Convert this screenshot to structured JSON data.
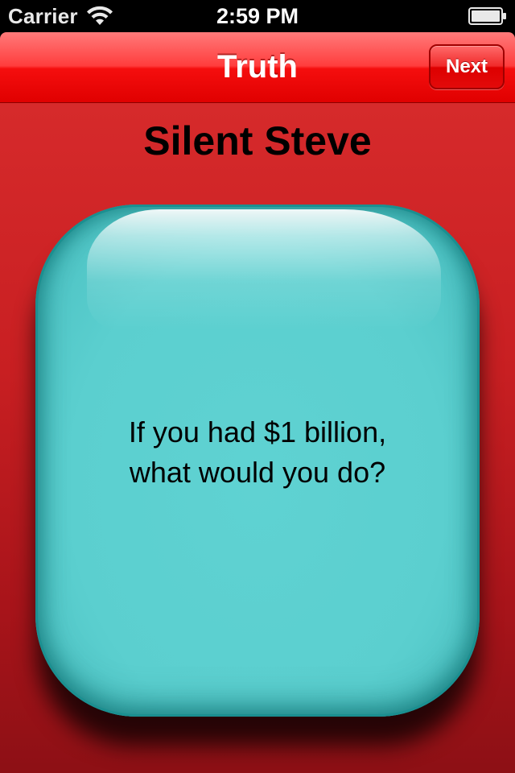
{
  "status_bar": {
    "carrier": "Carrier",
    "time": "2:59 PM",
    "wifi_icon": "wifi-icon",
    "battery_icon": "battery-full-icon"
  },
  "nav": {
    "title": "Truth",
    "next_label": "Next",
    "bar_color": "#f01414"
  },
  "player": {
    "name": "Silent Steve"
  },
  "card": {
    "question_line1": "If you had $1 billion,",
    "question_line2": "what would you do?",
    "color": "#5ccfcf"
  },
  "theme": {
    "background": "#c41e22"
  }
}
